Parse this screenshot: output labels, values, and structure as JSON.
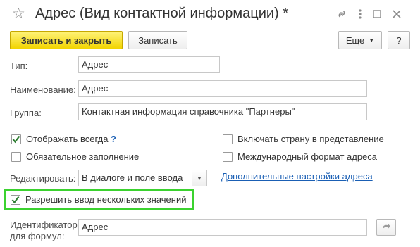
{
  "window": {
    "title": "Адрес (Вид контактной информации) *"
  },
  "toolbar": {
    "save_close_label": "Записать и закрыть",
    "save_label": "Записать",
    "more_label": "Еще",
    "help_label": "?"
  },
  "form": {
    "type_label": "Тип:",
    "type_value": "Адрес",
    "name_label": "Наименование:",
    "name_value": "Адрес",
    "group_label": "Группа:",
    "group_value": "Контактная информация справочника \"Партнеры\"",
    "show_always_label": "Отображать всегда",
    "show_always_checked": true,
    "show_always_help": "?",
    "required_label": "Обязательное заполнение",
    "required_checked": false,
    "edit_label": "Редактировать:",
    "edit_value": "В диалоге и поле ввода",
    "multiple_label": "Разрешить ввод нескольких значений",
    "multiple_checked": true,
    "include_country_label": "Включать страну в представление",
    "include_country_checked": false,
    "intl_format_label": "Международный формат адреса",
    "intl_format_checked": false,
    "advanced_link": "Дополнительные настройки адреса",
    "identifier_label_line1": "Идентификатор",
    "identifier_label_line2": "для формул:",
    "identifier_value": "Адрес"
  },
  "colors": {
    "primary_button": "#f5d800",
    "highlight": "#3bd22f",
    "link": "#1a5fb4"
  },
  "icons": {
    "star": "star-icon",
    "link": "link-icon",
    "menu": "kebab-icon",
    "minimize": "minimize-icon",
    "close": "close-icon",
    "dropdown": "dropdown-arrow-icon",
    "update": "update-icon"
  }
}
